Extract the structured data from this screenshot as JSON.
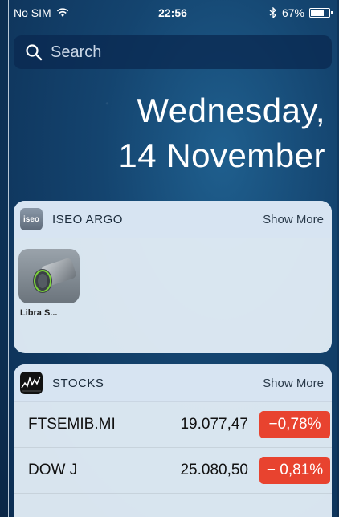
{
  "status_bar": {
    "carrier": "No SIM",
    "time": "22:56",
    "battery": "67%",
    "battery_level": 0.67,
    "icons": [
      "wifi-icon",
      "bluetooth-icon",
      "battery-icon"
    ]
  },
  "search": {
    "placeholder": "Search",
    "icon": "search-icon"
  },
  "date": {
    "line1": "Wednesday,",
    "line2": "14 November"
  },
  "widgets": {
    "iseo": {
      "title": "ISEO ARGO",
      "show_more": "Show More",
      "app_icon_text": "iseo",
      "items": [
        {
          "label": "Libra S..."
        }
      ]
    },
    "stocks": {
      "title": "STOCKS",
      "show_more": "Show More",
      "rows": [
        {
          "symbol": "FTSEMIB.MI",
          "value": "19.077,47",
          "change": "−0,78%"
        },
        {
          "symbol": "DOW J",
          "value": "25.080,50",
          "change": "− 0,81%"
        }
      ],
      "accent_negative": "#e8432f"
    }
  }
}
